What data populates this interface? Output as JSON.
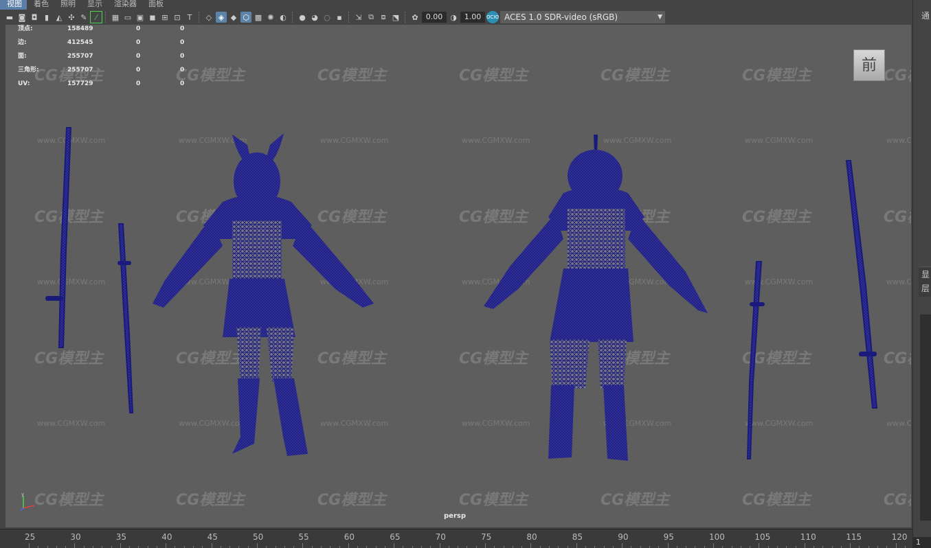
{
  "menu": {
    "items": [
      "视图",
      "着色",
      "照明",
      "显示",
      "渲染器",
      "面板"
    ]
  },
  "toolbar": {
    "exposure_value": "0.00",
    "gamma_value": "1.00",
    "color_space": "ACES 1.0 SDR-video (sRGB)",
    "color_space_icon": "OCIO"
  },
  "hud": {
    "rows": [
      {
        "label": "顶点:",
        "v1": "158489",
        "v2": "0",
        "v3": "0"
      },
      {
        "label": "边:",
        "v1": "412545",
        "v2": "0",
        "v3": "0"
      },
      {
        "label": "面:",
        "v1": "255707",
        "v2": "0",
        "v3": "0"
      },
      {
        "label": "三角形:",
        "v1": "255707",
        "v2": "0",
        "v3": "0"
      },
      {
        "label": "UV:",
        "v1": "157729",
        "v2": "0",
        "v3": "0"
      }
    ]
  },
  "viewcube": {
    "face": "前"
  },
  "camera_label": "persp",
  "watermark": {
    "logo": "CG模型主",
    "url": "www.CGMXW.com"
  },
  "timeline": {
    "ticks": [
      "25",
      "30",
      "35",
      "40",
      "45",
      "50",
      "55",
      "60",
      "65",
      "70",
      "75",
      "80",
      "85",
      "90",
      "95",
      "100",
      "105",
      "110",
      "115",
      "120"
    ],
    "current_frame": "1"
  },
  "right_panel": {
    "top_text": "通",
    "mid_text_1": "显",
    "mid_text_2": "层"
  },
  "colors": {
    "viewport_bg": "#5e5e5e",
    "wireframe": "#1a1a7a",
    "accent": "#5a7ea8"
  },
  "icons": [
    "camera-icon",
    "grid-icon",
    "wireframe-icon",
    "smooth-shade-icon",
    "light-icon",
    "isolate-icon",
    "exposure-icon",
    "gamma-icon",
    "color-management-icon"
  ]
}
